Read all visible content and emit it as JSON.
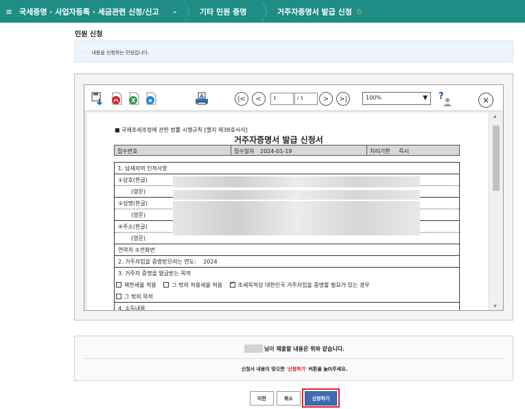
{
  "breadcrumb": {
    "menu_icon": "≡",
    "level1": "국세증명 · 사업자등록 · 세금관련 신청/신고",
    "level2": "기타 민원 증명",
    "level3": "거주자증명서 발급 신청",
    "star_icon": "☆"
  },
  "page_title": "민원 신청",
  "notice": {
    "text": "내용을 신청하는 민원입니다."
  },
  "viewer": {
    "toolbar": {
      "save_icon": "save-icon",
      "pdf_icon": "pdf-icon",
      "excel_icon": "excel-icon",
      "hwp_icon": "hwp-icon",
      "print_icon": "print-icon",
      "page_current": "1",
      "page_total": "/ 1",
      "zoom": "100%",
      "first_glyph": "|<",
      "prev_glyph": "<",
      "next_glyph": ">",
      "last_glyph": ">|",
      "close_glyph": "×"
    },
    "document": {
      "head_note": "■ 국제조세조정에 관한 법률 시행규칙 [별지 제38호서식]",
      "form_title": "거주자증명서 발급 신청서",
      "meta": {
        "receipt_no_label": "접수번호",
        "receipt_date_label": "접수일자",
        "receipt_date": "2024-01-19",
        "period_label": "처리기한",
        "period_value": "즉시"
      },
      "rows": {
        "section1": "1. 납세자의 인적사항",
        "trade_name": "①상호(한글)",
        "trade_name_en": "(영문)",
        "name": "②성명(한글)",
        "name_en": "(영문)",
        "address": "④주소(한글)",
        "address_en": "(영문)",
        "contact": "연락처     ⑤전화번",
        "section2_label": "2. 거주자임을 증명받으려는 연도:",
        "section2_year": "2024",
        "section3": "3. 거주자 증명을 발급받는 목적",
        "opt1": "제한세율 적용",
        "opt2": "그 밖의 적용세율 적용",
        "opt3": "조세목적상 대한민국 거주자임을 증명할 필요가 있는 경우",
        "opt4": "그 밖의 목적",
        "section4": "4. 소득내용"
      }
    }
  },
  "confirm": {
    "main": "님이 제출할 내용은 위와 같습니다.",
    "sub_prefix": "신청서 내용이 맞으면",
    "sub_highlight": "'신청하기'",
    "sub_suffix": "버튼을 눌러주세요."
  },
  "buttons": {
    "prev": "이전",
    "cancel": "취소",
    "apply": "신청하기"
  },
  "colors": {
    "topbar": "#1f8c86",
    "apply_button": "#3c6db2",
    "highlight_border": "#e02020"
  }
}
